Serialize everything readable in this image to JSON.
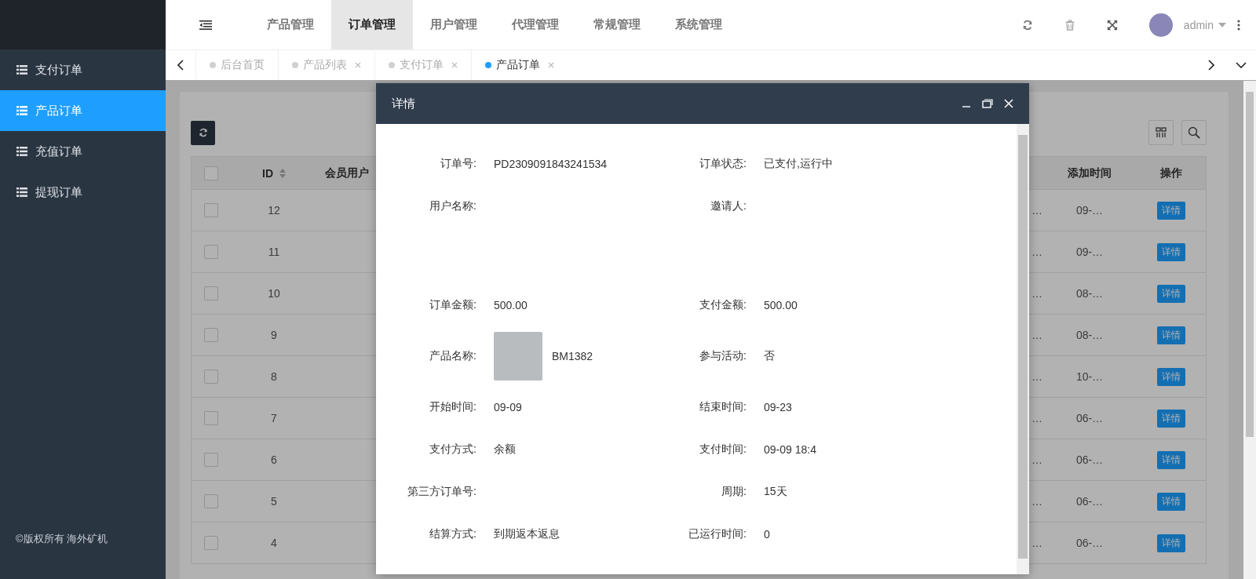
{
  "sidebar": {
    "items": [
      {
        "label": "支付订单",
        "selected": false
      },
      {
        "label": "产品订单",
        "selected": true
      },
      {
        "label": "充值订单",
        "selected": false
      },
      {
        "label": "提现订单",
        "selected": false
      }
    ],
    "footer": "©版权所有 海外矿机"
  },
  "top_nav": {
    "items": [
      {
        "label": "产品管理",
        "selected": false
      },
      {
        "label": "订单管理",
        "selected": true
      },
      {
        "label": "用户管理",
        "selected": false
      },
      {
        "label": "代理管理",
        "selected": false
      },
      {
        "label": "常规管理",
        "selected": false
      },
      {
        "label": "系统管理",
        "selected": false
      }
    ],
    "user": "admin"
  },
  "tabs": [
    {
      "label": "后台首页",
      "selected": false,
      "closable": false
    },
    {
      "label": "产品列表",
      "selected": false,
      "closable": true
    },
    {
      "label": "支付订单",
      "selected": false,
      "closable": true
    },
    {
      "label": "产品订单",
      "selected": true,
      "closable": true
    }
  ],
  "table": {
    "columns": [
      "ID",
      "会员用户",
      "",
      "添加时间",
      "操作"
    ],
    "all_checked": false,
    "rows": [
      {
        "checked": false,
        "id": "12",
        "column_5": "…",
        "add_time": "09-…",
        "action": "详情"
      },
      {
        "checked": false,
        "id": "11",
        "column_5": "…",
        "add_time": "09-…",
        "action": "详情"
      },
      {
        "checked": false,
        "id": "10",
        "column_5": "…",
        "add_time": "08-…",
        "action": "详情"
      },
      {
        "checked": false,
        "id": "9",
        "column_5": "…",
        "add_time": "08-…",
        "action": "详情"
      },
      {
        "checked": false,
        "id": "8",
        "column_5": "…",
        "add_time": "10-…",
        "action": "详情"
      },
      {
        "checked": false,
        "id": "7",
        "column_5": "…",
        "add_time": "06-…",
        "action": "详情"
      },
      {
        "checked": false,
        "id": "6",
        "column_5": "…",
        "add_time": "06-…",
        "action": "详情"
      },
      {
        "checked": false,
        "id": "5",
        "column_5": "…",
        "add_time": "06-…",
        "action": "详情"
      },
      {
        "checked": false,
        "id": "4",
        "column_5": "…",
        "add_time": "06-…",
        "action": "详情"
      }
    ]
  },
  "dialog": {
    "title": "详情",
    "rows": [
      {
        "left": {
          "label": "订单号:",
          "value": "PD2309091843241534"
        },
        "right": {
          "label": "订单状态:",
          "value": "已支付,运行中"
        }
      },
      {
        "left": {
          "label": "用户名称:"
        },
        "right": {
          "label": "邀请人:"
        }
      },
      {
        "left": {
          "label": "订单金额:",
          "value": "500.00"
        },
        "right": {
          "label": "支付金额:",
          "value": "500.00"
        }
      },
      {
        "left": {
          "label": "产品名称:",
          "value": "BM1382",
          "kind": "product"
        },
        "right": {
          "label": "参与活动:",
          "value": "否"
        }
      },
      {
        "left": {
          "label": "开始时间:",
          "value": "09-09"
        },
        "right": {
          "label": "结束时间:",
          "value": "09-23"
        }
      },
      {
        "left": {
          "label": "支付方式:",
          "value": "余额"
        },
        "right": {
          "label": "支付时间:",
          "value": "09-09 18:4"
        }
      },
      {
        "left": {
          "label": "第三方订单号:"
        },
        "right": {
          "label": "周期:",
          "value": "15天"
        }
      },
      {
        "left": {
          "label": "结算方式:",
          "value": "到期返本返息"
        },
        "right": {
          "label": "已运行时间:",
          "value": "0"
        }
      }
    ]
  }
}
